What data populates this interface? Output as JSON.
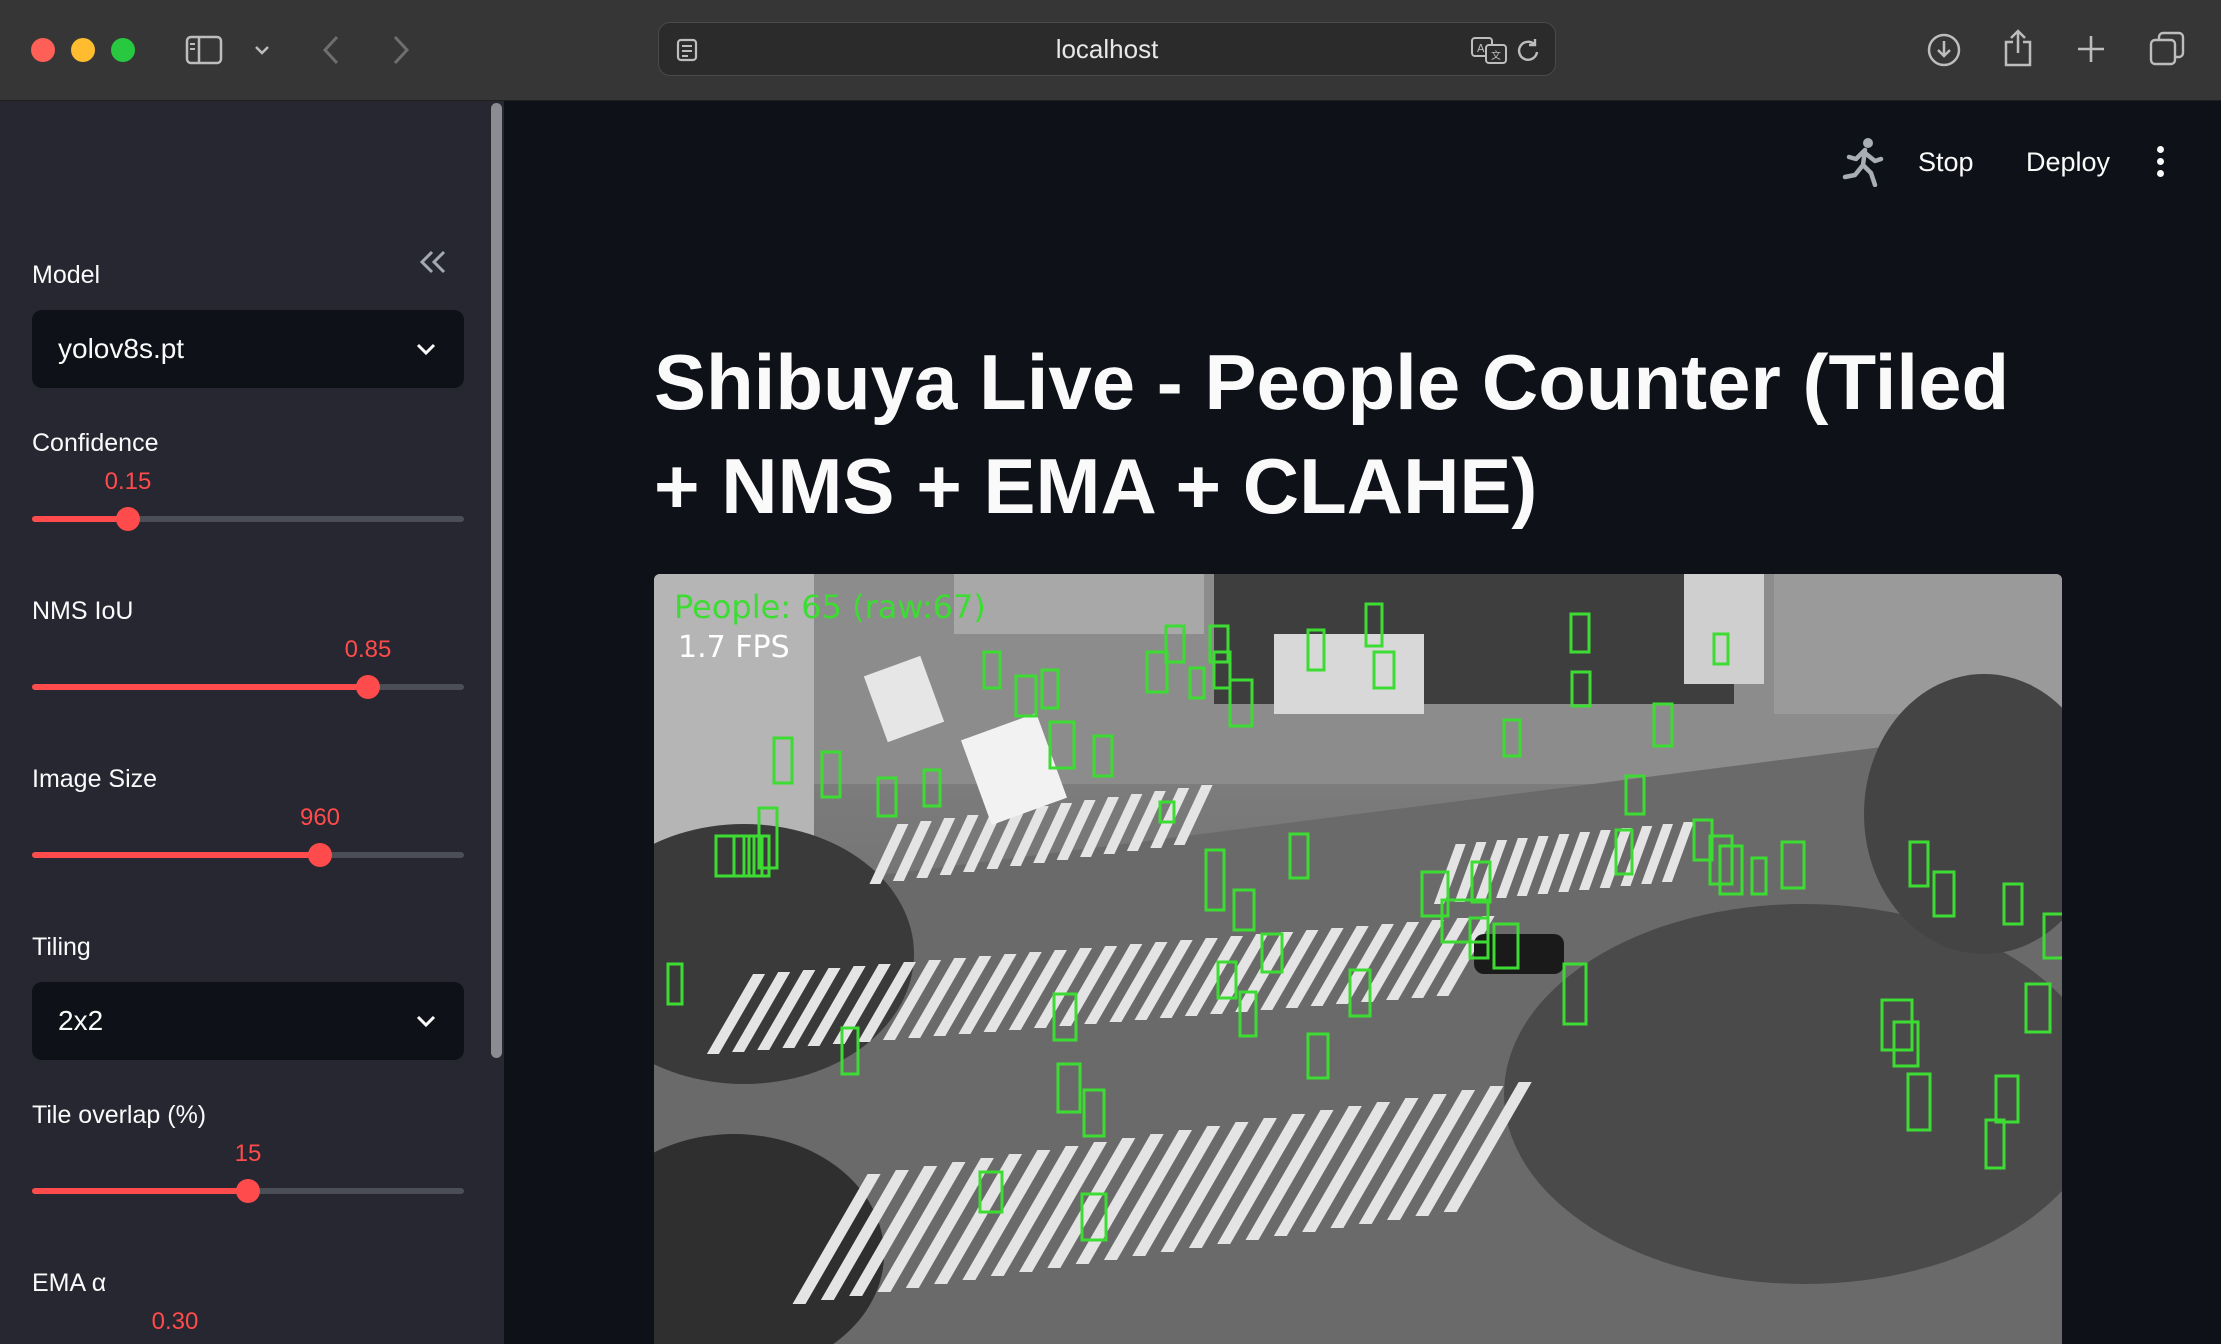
{
  "browser": {
    "url": "localhost",
    "icons": [
      "sidebar-toggle-icon",
      "chevron-down-icon",
      "back-arrow-icon",
      "forward-arrow-icon",
      "page-icon",
      "translate-icon",
      "reload-icon",
      "download-icon",
      "share-icon",
      "new-tab-icon",
      "tab-overview-icon"
    ]
  },
  "toolbar": {
    "stop_label": "Stop",
    "deploy_label": "Deploy",
    "running_icon": "running-man-icon",
    "menu_icon": "kebab-menu-icon"
  },
  "sidebar": {
    "collapse_icon": "double-chevron-left-icon",
    "model": {
      "label": "Model",
      "value": "yolov8s.pt"
    },
    "confidence": {
      "label": "Confidence",
      "value": "0.15",
      "fraction": 0.15
    },
    "nms_iou": {
      "label": "NMS IoU",
      "value": "0.85",
      "fraction": 0.85
    },
    "image_size": {
      "label": "Image Size",
      "value": "960",
      "fraction": 0.66
    },
    "tiling": {
      "label": "Tiling",
      "value": "2x2"
    },
    "tile_overlap": {
      "label": "Tile overlap (%)",
      "value": "15",
      "fraction": 0.5
    },
    "ema_alpha": {
      "label": "EMA α",
      "value": "0.30"
    }
  },
  "main": {
    "title": "Shibuya Live - People Counter (Tiled + NMS + EMA + CLAHE)",
    "video": {
      "people_text": "People: 65 (raw:67)",
      "fps_text": "1.7 FPS",
      "box_color": "#3ddc33"
    }
  },
  "colors": {
    "accent": "#ff4b4b",
    "sidebar_bg": "#262730",
    "main_bg": "#0e1117"
  }
}
